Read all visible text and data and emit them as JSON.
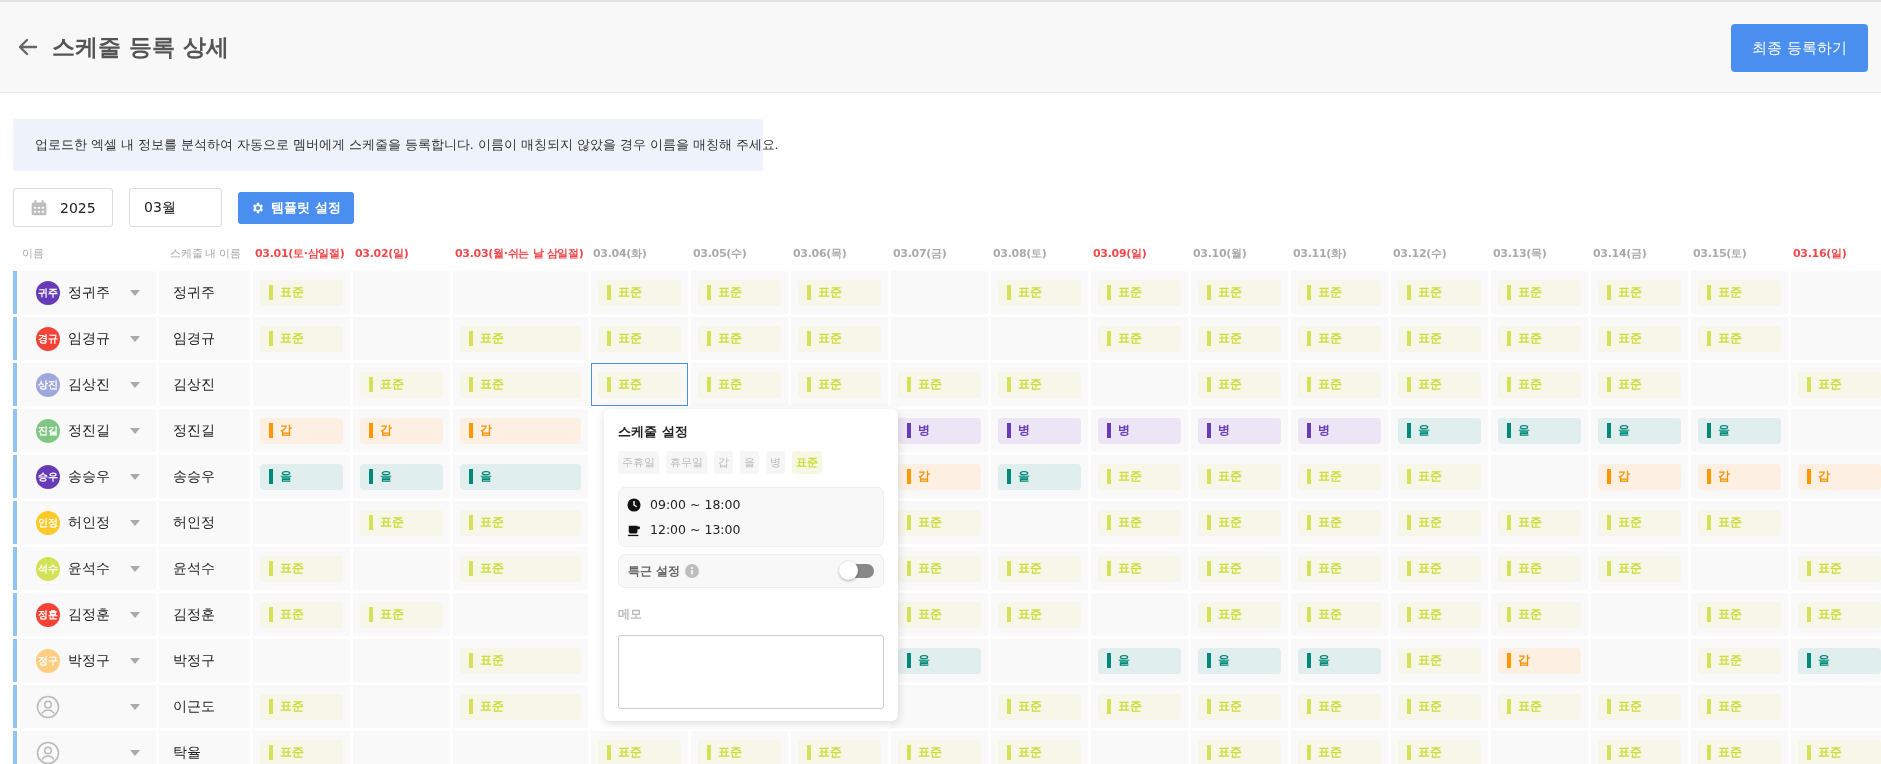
{
  "header": {
    "title": "스케줄 등록 상세",
    "submit_button": "최종 등록하기"
  },
  "notice": "업로드한 엑셀 내 정보를 분석하여 자동으로 멤버에게 스케줄을 등록합니다. 이름이 매칭되지 않았을 경우 이름을 매칭해 주세요.",
  "filters": {
    "year": "2025",
    "month": "03월",
    "template_button": "템플릿 설정"
  },
  "table": {
    "name_column": "이름",
    "schedule_name_column": "스케줄 내 이름",
    "date_columns": [
      {
        "label": "03.01(토·삼일절)",
        "holiday": true
      },
      {
        "label": "03.02(일)",
        "holiday": true
      },
      {
        "label": "03.03(월·쉬는 날 삼일절)",
        "holiday": true
      },
      {
        "label": "03.04(화)",
        "holiday": false
      },
      {
        "label": "03.05(수)",
        "holiday": false
      },
      {
        "label": "03.06(목)",
        "holiday": false
      },
      {
        "label": "03.07(금)",
        "holiday": false
      },
      {
        "label": "03.08(토)",
        "holiday": false
      },
      {
        "label": "03.09(일)",
        "holiday": true
      },
      {
        "label": "03.10(월)",
        "holiday": false
      },
      {
        "label": "03.11(화)",
        "holiday": false
      },
      {
        "label": "03.12(수)",
        "holiday": false
      },
      {
        "label": "03.13(목)",
        "holiday": false
      },
      {
        "label": "03.14(금)",
        "holiday": false
      },
      {
        "label": "03.15(토)",
        "holiday": false
      },
      {
        "label": "03.16(일)",
        "holiday": true
      }
    ],
    "rows": [
      {
        "member": {
          "kind": "matched",
          "avatar": "귀주",
          "name": "정귀주",
          "color": "#673ab7"
        },
        "schedule_name": "정귀주",
        "cells": [
          {
            "kind": "standard",
            "label": "표준",
            "selected": false
          },
          null,
          null,
          {
            "kind": "standard",
            "label": "표준",
            "selected": false
          },
          {
            "kind": "standard",
            "label": "표준",
            "selected": false
          },
          {
            "kind": "standard",
            "label": "표준",
            "selected": false
          },
          null,
          {
            "kind": "standard",
            "label": "표준",
            "selected": false
          },
          {
            "kind": "standard",
            "label": "표준",
            "selected": false
          },
          {
            "kind": "standard",
            "label": "표준",
            "selected": false
          },
          {
            "kind": "standard",
            "label": "표준",
            "selected": false
          },
          {
            "kind": "standard",
            "label": "표준",
            "selected": false
          },
          {
            "kind": "standard",
            "label": "표준",
            "selected": false
          },
          {
            "kind": "standard",
            "label": "표준",
            "selected": false
          },
          {
            "kind": "standard",
            "label": "표준",
            "selected": false
          },
          null
        ]
      },
      {
        "member": {
          "kind": "matched",
          "avatar": "경규",
          "name": "임경규",
          "color": "#f44336"
        },
        "schedule_name": "임경규",
        "cells": [
          {
            "kind": "standard",
            "label": "표준",
            "selected": false
          },
          null,
          {
            "kind": "standard",
            "label": "표준",
            "selected": false
          },
          {
            "kind": "standard",
            "label": "표준",
            "selected": false
          },
          {
            "kind": "standard",
            "label": "표준",
            "selected": false
          },
          {
            "kind": "standard",
            "label": "표준",
            "selected": false
          },
          null,
          null,
          {
            "kind": "standard",
            "label": "표준",
            "selected": false
          },
          {
            "kind": "standard",
            "label": "표준",
            "selected": false
          },
          {
            "kind": "standard",
            "label": "표준",
            "selected": false
          },
          {
            "kind": "standard",
            "label": "표준",
            "selected": false
          },
          {
            "kind": "standard",
            "label": "표준",
            "selected": false
          },
          {
            "kind": "standard",
            "label": "표준",
            "selected": false
          },
          {
            "kind": "standard",
            "label": "표준",
            "selected": false
          },
          null
        ]
      },
      {
        "member": {
          "kind": "matched",
          "avatar": "상진",
          "name": "김상진",
          "color": "#9fa8da"
        },
        "schedule_name": "김상진",
        "cells": [
          null,
          {
            "kind": "standard",
            "label": "표준",
            "selected": false
          },
          {
            "kind": "standard",
            "label": "표준",
            "selected": false
          },
          {
            "kind": "standard",
            "label": "표준",
            "selected": true
          },
          {
            "kind": "standard",
            "label": "표준",
            "selected": false
          },
          {
            "kind": "standard",
            "label": "표준",
            "selected": false
          },
          {
            "kind": "standard",
            "label": "표준",
            "selected": false
          },
          {
            "kind": "standard",
            "label": "표준",
            "selected": false
          },
          null,
          {
            "kind": "standard",
            "label": "표준",
            "selected": false
          },
          {
            "kind": "standard",
            "label": "표준",
            "selected": false
          },
          {
            "kind": "standard",
            "label": "표준",
            "selected": false
          },
          {
            "kind": "standard",
            "label": "표준",
            "selected": false
          },
          {
            "kind": "standard",
            "label": "표준",
            "selected": false
          },
          null,
          {
            "kind": "standard",
            "label": "표준",
            "selected": false
          }
        ]
      },
      {
        "member": {
          "kind": "matched",
          "avatar": "진길",
          "name": "정진길",
          "color": "#81c784"
        },
        "schedule_name": "정진길",
        "cells": [
          {
            "kind": "shift_a",
            "label": "갑",
            "selected": false
          },
          {
            "kind": "shift_a",
            "label": "갑",
            "selected": false
          },
          {
            "kind": "shift_a",
            "label": "갑",
            "selected": false
          },
          null,
          null,
          null,
          {
            "kind": "shift_c",
            "label": "병",
            "selected": false
          },
          {
            "kind": "shift_c",
            "label": "병",
            "selected": false
          },
          {
            "kind": "shift_c",
            "label": "병",
            "selected": false
          },
          {
            "kind": "shift_c",
            "label": "병",
            "selected": false
          },
          {
            "kind": "shift_c",
            "label": "병",
            "selected": false
          },
          {
            "kind": "shift_b",
            "label": "을",
            "selected": false
          },
          {
            "kind": "shift_b",
            "label": "을",
            "selected": false
          },
          {
            "kind": "shift_b",
            "label": "을",
            "selected": false
          },
          {
            "kind": "shift_b",
            "label": "을",
            "selected": false
          },
          null
        ]
      },
      {
        "member": {
          "kind": "matched",
          "avatar": "승우",
          "name": "송승우",
          "color": "#673ab7"
        },
        "schedule_name": "송승우",
        "cells": [
          {
            "kind": "shift_b",
            "label": "을",
            "selected": false
          },
          {
            "kind": "shift_b",
            "label": "을",
            "selected": false
          },
          {
            "kind": "shift_b",
            "label": "을",
            "selected": false
          },
          null,
          null,
          null,
          {
            "kind": "shift_a",
            "label": "갑",
            "selected": false
          },
          {
            "kind": "shift_b",
            "label": "을",
            "selected": false
          },
          {
            "kind": "standard",
            "label": "표준",
            "selected": false
          },
          {
            "kind": "standard",
            "label": "표준",
            "selected": false
          },
          {
            "kind": "standard",
            "label": "표준",
            "selected": false
          },
          {
            "kind": "standard",
            "label": "표준",
            "selected": false
          },
          null,
          {
            "kind": "shift_a",
            "label": "갑",
            "selected": false
          },
          {
            "kind": "shift_a",
            "label": "갑",
            "selected": false
          },
          {
            "kind": "shift_a",
            "label": "갑",
            "selected": false
          }
        ]
      },
      {
        "member": {
          "kind": "matched",
          "avatar": "인정",
          "name": "허인정",
          "color": "#ffca28"
        },
        "schedule_name": "허인정",
        "cells": [
          null,
          {
            "kind": "standard",
            "label": "표준",
            "selected": false
          },
          {
            "kind": "standard",
            "label": "표준",
            "selected": false
          },
          null,
          null,
          null,
          {
            "kind": "standard",
            "label": "표준",
            "selected": false
          },
          null,
          {
            "kind": "standard",
            "label": "표준",
            "selected": false
          },
          {
            "kind": "standard",
            "label": "표준",
            "selected": false
          },
          {
            "kind": "standard",
            "label": "표준",
            "selected": false
          },
          {
            "kind": "standard",
            "label": "표준",
            "selected": false
          },
          {
            "kind": "standard",
            "label": "표준",
            "selected": false
          },
          {
            "kind": "standard",
            "label": "표준",
            "selected": false
          },
          {
            "kind": "standard",
            "label": "표준",
            "selected": false
          },
          null
        ]
      },
      {
        "member": {
          "kind": "matched",
          "avatar": "석수",
          "name": "윤석수",
          "color": "#d4e157"
        },
        "schedule_name": "윤석수",
        "cells": [
          {
            "kind": "standard",
            "label": "표준",
            "selected": false
          },
          null,
          {
            "kind": "standard",
            "label": "표준",
            "selected": false
          },
          null,
          null,
          null,
          {
            "kind": "standard",
            "label": "표준",
            "selected": false
          },
          {
            "kind": "standard",
            "label": "표준",
            "selected": false
          },
          {
            "kind": "standard",
            "label": "표준",
            "selected": false
          },
          {
            "kind": "standard",
            "label": "표준",
            "selected": false
          },
          {
            "kind": "standard",
            "label": "표준",
            "selected": false
          },
          {
            "kind": "standard",
            "label": "표준",
            "selected": false
          },
          {
            "kind": "standard",
            "label": "표준",
            "selected": false
          },
          {
            "kind": "standard",
            "label": "표준",
            "selected": false
          },
          null,
          {
            "kind": "standard",
            "label": "표준",
            "selected": false
          }
        ]
      },
      {
        "member": {
          "kind": "matched",
          "avatar": "정훈",
          "name": "김정훈",
          "color": "#f44336"
        },
        "schedule_name": "김정훈",
        "cells": [
          {
            "kind": "standard",
            "label": "표준",
            "selected": false
          },
          {
            "kind": "standard",
            "label": "표준",
            "selected": false
          },
          null,
          null,
          null,
          null,
          {
            "kind": "standard",
            "label": "표준",
            "selected": false
          },
          {
            "kind": "standard",
            "label": "표준",
            "selected": false
          },
          null,
          {
            "kind": "standard",
            "label": "표준",
            "selected": false
          },
          {
            "kind": "standard",
            "label": "표준",
            "selected": false
          },
          {
            "kind": "standard",
            "label": "표준",
            "selected": false
          },
          {
            "kind": "standard",
            "label": "표준",
            "selected": false
          },
          null,
          {
            "kind": "standard",
            "label": "표준",
            "selected": false
          },
          {
            "kind": "standard",
            "label": "표준",
            "selected": false
          }
        ]
      },
      {
        "member": {
          "kind": "matched",
          "avatar": "정구",
          "name": "박정구",
          "color": "#ffcc80"
        },
        "schedule_name": "박정구",
        "cells": [
          null,
          null,
          {
            "kind": "standard",
            "label": "표준",
            "selected": false
          },
          null,
          null,
          null,
          {
            "kind": "shift_b",
            "label": "을",
            "selected": false
          },
          null,
          {
            "kind": "shift_b",
            "label": "을",
            "selected": false
          },
          {
            "kind": "shift_b",
            "label": "을",
            "selected": false
          },
          {
            "kind": "shift_b",
            "label": "을",
            "selected": false
          },
          {
            "kind": "standard",
            "label": "표준",
            "selected": false
          },
          {
            "kind": "shift_a",
            "label": "갑",
            "selected": false
          },
          null,
          {
            "kind": "standard",
            "label": "표준",
            "selected": false
          },
          {
            "kind": "shift_b",
            "label": "을",
            "selected": false
          }
        ]
      },
      {
        "member": {
          "kind": "unmatched"
        },
        "schedule_name": "이근도",
        "cells": [
          {
            "kind": "standard",
            "label": "표준",
            "selected": false
          },
          null,
          {
            "kind": "standard",
            "label": "표준",
            "selected": false
          },
          null,
          null,
          null,
          null,
          {
            "kind": "standard",
            "label": "표준",
            "selected": false
          },
          {
            "kind": "standard",
            "label": "표준",
            "selected": false
          },
          {
            "kind": "standard",
            "label": "표준",
            "selected": false
          },
          {
            "kind": "standard",
            "label": "표준",
            "selected": false
          },
          {
            "kind": "standard",
            "label": "표준",
            "selected": false
          },
          {
            "kind": "standard",
            "label": "표준",
            "selected": false
          },
          {
            "kind": "standard",
            "label": "표준",
            "selected": false
          },
          {
            "kind": "standard",
            "label": "표준",
            "selected": false
          },
          null
        ]
      },
      {
        "member": {
          "kind": "unmatched"
        },
        "schedule_name": "탁율",
        "cells": [
          {
            "kind": "standard",
            "label": "표준",
            "selected": false
          },
          null,
          null,
          {
            "kind": "standard",
            "label": "표준",
            "selected": false
          },
          {
            "kind": "standard",
            "label": "표준",
            "selected": false
          },
          {
            "kind": "standard",
            "label": "표준",
            "selected": false
          },
          {
            "kind": "standard",
            "label": "표준",
            "selected": false
          },
          {
            "kind": "standard",
            "label": "표준",
            "selected": false
          },
          null,
          {
            "kind": "standard",
            "label": "표준",
            "selected": false
          },
          {
            "kind": "standard",
            "label": "표준",
            "selected": false
          },
          {
            "kind": "standard",
            "label": "표준",
            "selected": false
          },
          null,
          {
            "kind": "standard",
            "label": "표준",
            "selected": false
          },
          {
            "kind": "standard",
            "label": "표준",
            "selected": false
          },
          {
            "kind": "standard",
            "label": "표준",
            "selected": false
          }
        ]
      }
    ]
  },
  "popover": {
    "title": "스케줄 설정",
    "types": [
      {
        "label": "주휴일",
        "selected": false
      },
      {
        "label": "휴무일",
        "selected": false
      },
      {
        "label": "갑",
        "selected": false
      },
      {
        "label": "을",
        "selected": false
      },
      {
        "label": "병",
        "selected": false
      },
      {
        "label": "표준",
        "selected": true
      }
    ],
    "work_time": "09:00 ~ 18:00",
    "break_time": "12:00 ~ 13:00",
    "overtime": {
      "label": "특근 설정",
      "on": false
    },
    "memo_label": "메모"
  }
}
